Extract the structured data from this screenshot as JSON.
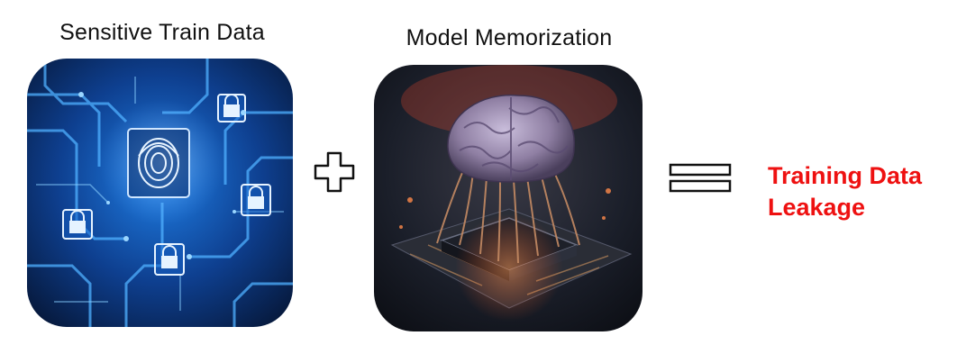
{
  "left_panel": {
    "caption": "Sensitive Train Data",
    "image": "circuit-board-fingerprint-lock-image"
  },
  "operator_plus": "plus-icon",
  "middle_panel": {
    "caption": "Model Memorization",
    "image": "brain-on-microchip-image"
  },
  "operator_equals": "equals-icon",
  "result": {
    "line1": "Training Data",
    "line2": "Leakage",
    "color": "#ee1111"
  },
  "colors": {
    "circuit_blue": "#1a6fd6",
    "circuit_dark": "#071a3a",
    "chip_dark": "#1b1f2a",
    "brain": "#8f7fa3",
    "glow": "#ff7a3c"
  }
}
